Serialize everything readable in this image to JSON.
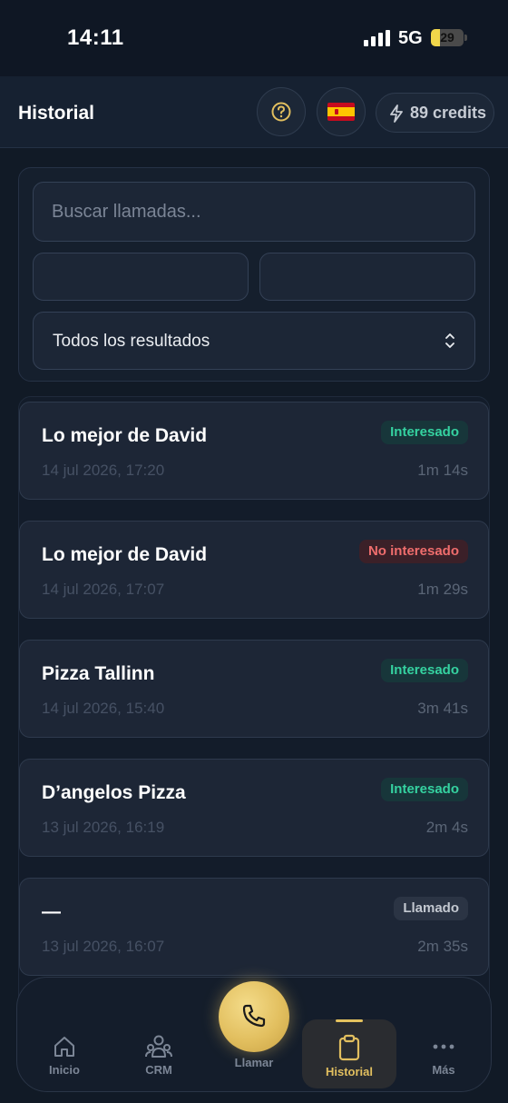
{
  "status_bar": {
    "time": "14:11",
    "network": "5G",
    "battery": "29",
    "battery_level": 0.29
  },
  "header": {
    "title": "Historial",
    "credits": "89 credits"
  },
  "filters": {
    "search_placeholder": "Buscar llamadas...",
    "date_from": "",
    "date_to": "",
    "result_filter": "Todos los resultados"
  },
  "calls": [
    {
      "name": "Lo mejor de David",
      "date": "14 jul 2026, 17:20",
      "duration": "1m 14s",
      "status": "Interesado",
      "status_color": "#35d2a0"
    },
    {
      "name": "Lo mejor de David",
      "date": "14 jul 2026, 17:07",
      "duration": "1m 29s",
      "status": "No interesado",
      "status_color": "#ef6d6d"
    },
    {
      "name": "Pizza Tallinn",
      "date": "14 jul 2026, 15:40",
      "duration": "3m 41s",
      "status": "Interesado",
      "status_color": "#35d2a0"
    },
    {
      "name": "D’angelos Pizza",
      "date": "13 jul 2026, 16:19",
      "duration": "2m 4s",
      "status": "Interesado",
      "status_color": "#35d2a0"
    },
    {
      "name": "—",
      "date": "13 jul 2026, 16:07",
      "duration": "2m 35s",
      "status": "Llamado",
      "status_color": "#c3c8d0"
    }
  ],
  "nav": {
    "items": [
      {
        "label": "Inicio",
        "icon": "home-icon"
      },
      {
        "label": "CRM",
        "icon": "people-icon"
      },
      {
        "label": "Llamar",
        "icon": "phone-icon"
      },
      {
        "label": "Historial",
        "icon": "clipboard-icon",
        "active": true
      },
      {
        "label": "Más",
        "icon": "more-dots-icon"
      }
    ]
  },
  "colors": {
    "accent": "#e2bf5f",
    "background": "#111a26",
    "card": "#1d2636"
  }
}
